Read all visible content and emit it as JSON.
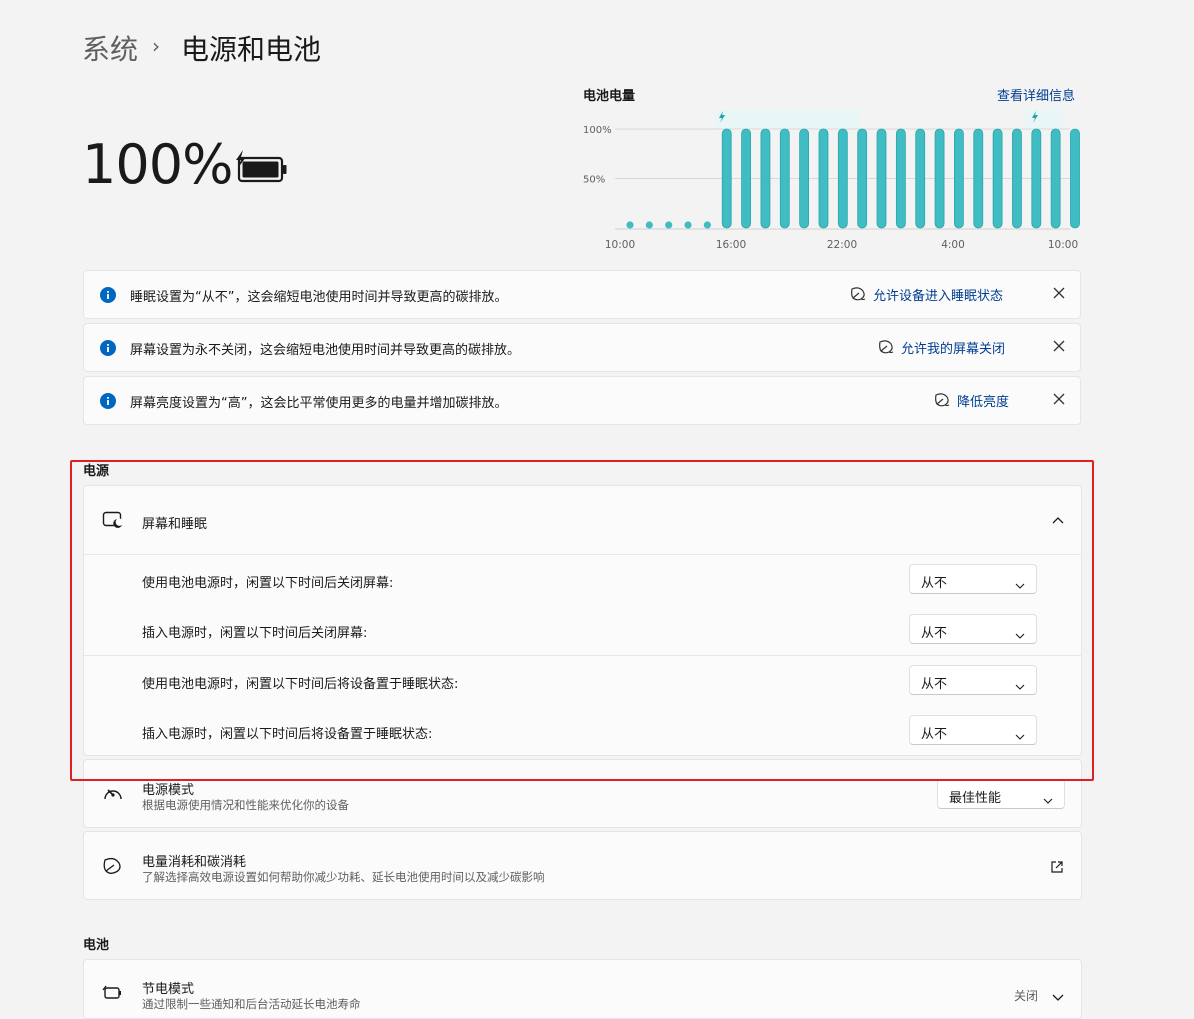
{
  "breadcrumb": {
    "parent": "系统",
    "separator": "›",
    "title": "电源和电池"
  },
  "battery": {
    "percent_text": "100%",
    "icon": "battery-charging-icon",
    "level_percent": 100
  },
  "chart": {
    "title": "电池电量",
    "link": "查看详细信息",
    "accent": "#3fbdc3"
  },
  "chart_data": {
    "type": "bar",
    "title": "电池电量",
    "y_ticks": [
      "100%",
      "50%"
    ],
    "x_ticks": [
      "10:00",
      "16:00",
      "22:00",
      "4:00",
      "10:00"
    ],
    "ylim": [
      0,
      100
    ],
    "values": [
      null,
      null,
      null,
      null,
      null,
      100,
      100,
      100,
      100,
      100,
      100,
      100,
      100,
      100,
      100,
      100,
      100,
      100,
      100,
      100,
      100,
      100,
      100,
      100
    ],
    "charging_marks": [
      "16:00",
      "9:00"
    ]
  },
  "notifications": [
    {
      "message": "睡眠设置为“从不”，这会缩短电池使用时间并导致更高的碳排放。",
      "action": "允许设备进入睡眠状态"
    },
    {
      "message": "屏幕设置为永不关闭，这会缩短电池使用时间并导致更高的碳排放。",
      "action": "允许我的屏幕关闭"
    },
    {
      "message": "屏幕亮度设置为“高”，这会比平常使用更多的电量并增加碳排放。",
      "action": "降低亮度"
    }
  ],
  "power_section": {
    "label": "电源",
    "screen_sleep": {
      "title": "屏幕和睡眠",
      "rows": [
        {
          "label": "使用电池电源时，闲置以下时间后关闭屏幕:",
          "value": "从不"
        },
        {
          "label": "插入电源时，闲置以下时间后关闭屏幕:",
          "value": "从不"
        },
        {
          "label": "使用电池电源时，闲置以下时间后将设备置于睡眠状态:",
          "value": "从不"
        },
        {
          "label": "插入电源时，闲置以下时间后将设备置于睡眠状态:",
          "value": "从不"
        }
      ]
    },
    "power_mode": {
      "title": "电源模式",
      "subtitle": "根据电源使用情况和性能来优化你的设备",
      "value": "最佳性能"
    },
    "energy": {
      "title": "电量消耗和碳消耗",
      "subtitle": "了解选择高效电源设置如何帮助你减少功耗、延长电池使用时间以及减少碳影响"
    }
  },
  "battery_section": {
    "label": "电池",
    "saver": {
      "title": "节电模式",
      "subtitle": "通过限制一些通知和后台活动延长电池寿命",
      "value": "关闭"
    }
  }
}
